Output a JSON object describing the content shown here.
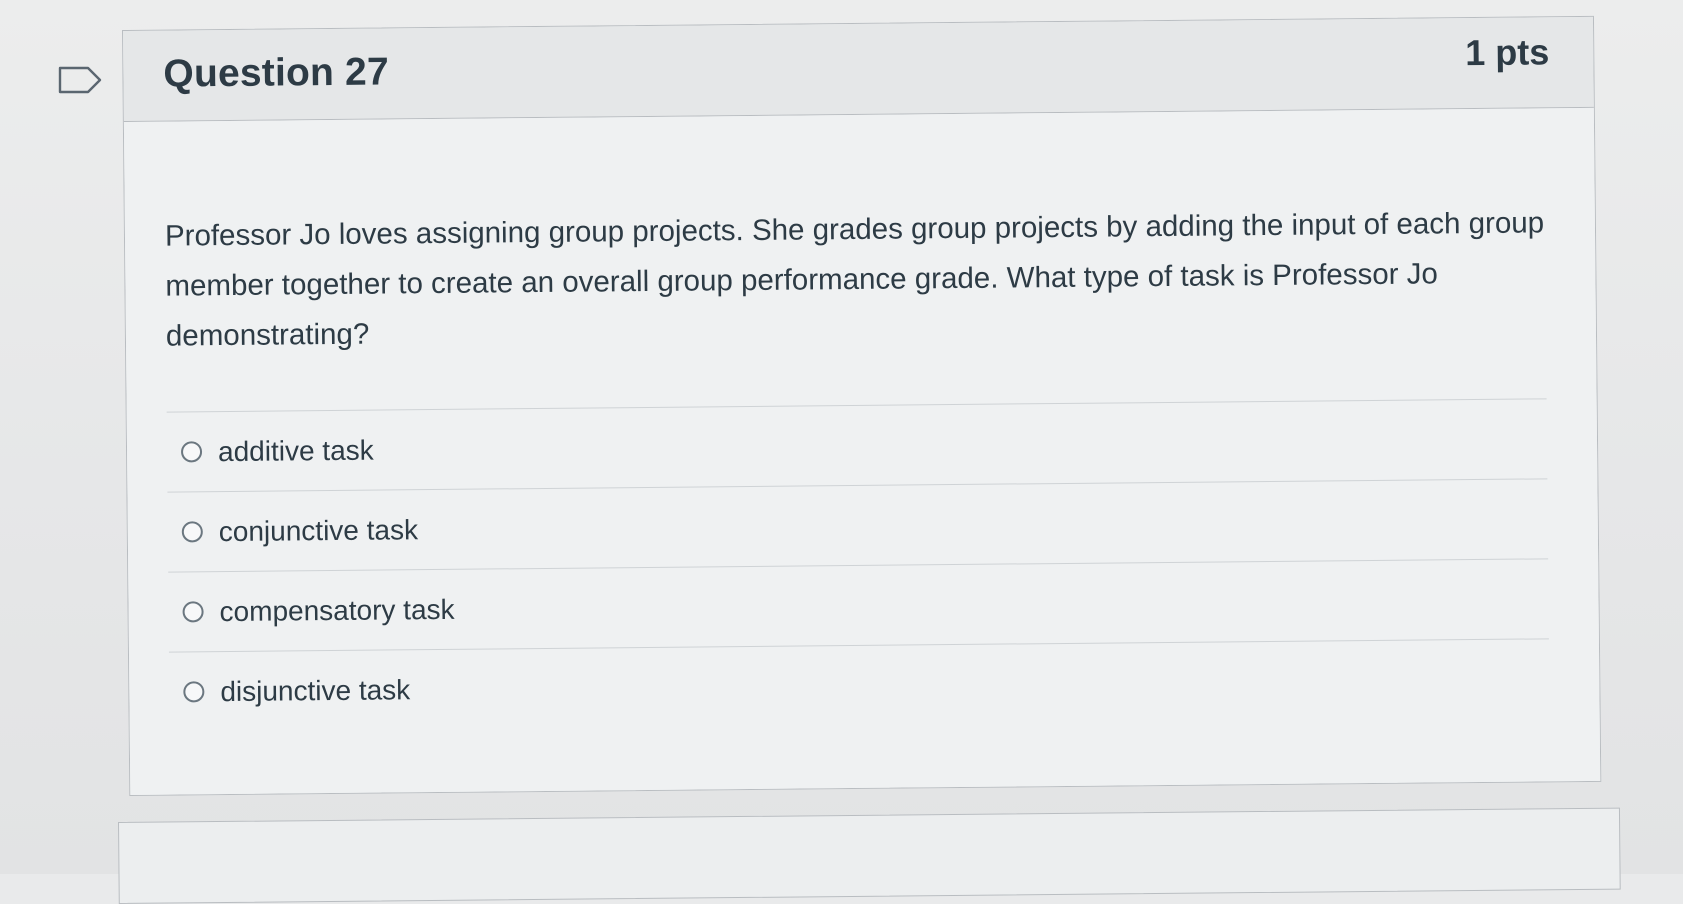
{
  "question": {
    "title": "Question 27",
    "points": "1 pts",
    "text": "Professor Jo loves assigning group projects. She grades group projects by adding the input of each group member together to create an overall group performance grade. What type of task is Professor Jo demonstrating?",
    "flag_icon": "flag-icon"
  },
  "answers": [
    {
      "label": "additive task",
      "selected": false
    },
    {
      "label": "conjunctive task",
      "selected": false
    },
    {
      "label": "compensatory task",
      "selected": false
    },
    {
      "label": "disjunctive task",
      "selected": false
    }
  ]
}
